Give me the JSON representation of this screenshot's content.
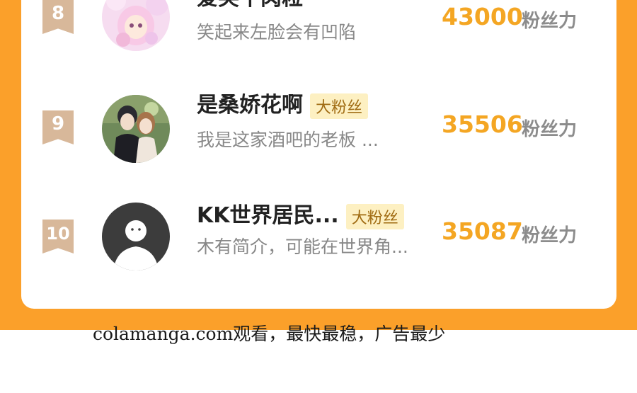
{
  "leaderboard": {
    "items": [
      {
        "rank": "8",
        "name": "爱笑牛肉粒",
        "badge": "",
        "bio": "笑起来左脸会有凹陷",
        "score": "43000",
        "score_unit": "粉丝力",
        "avatar_icon": "anime-girl-avatar"
      },
      {
        "rank": "9",
        "name": "是桑娇花啊",
        "badge": "大粉丝",
        "bio": "我是这家酒吧的老板 ...",
        "score": "35506",
        "score_unit": "粉丝力",
        "avatar_icon": "couple-avatar"
      },
      {
        "rank": "10",
        "name": "KK世界居民...",
        "badge": "大粉丝",
        "bio": "木有简介，可能在世界角...",
        "score": "35087",
        "score_unit": "粉丝力",
        "avatar_icon": "default-user-avatar"
      }
    ]
  },
  "footer": {
    "text": "colamanga.com观看，最快最稳，广告最少"
  },
  "colors": {
    "accent": "#fba02a",
    "score": "#f4a623",
    "badge_bg": "#fdf0c2",
    "rank_badge": "#d8b89a"
  }
}
